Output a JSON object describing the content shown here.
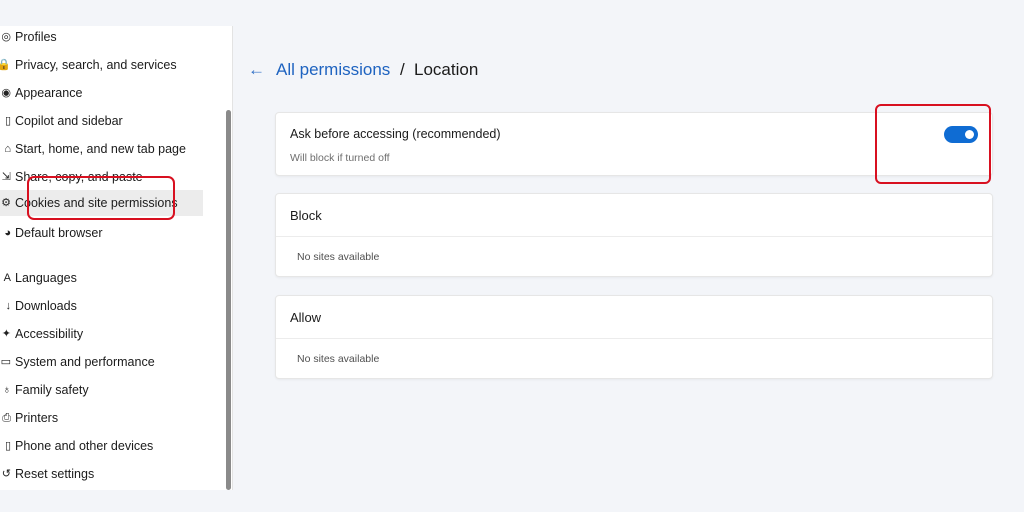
{
  "sidebar": {
    "items": [
      {
        "label": "Profiles",
        "icon": "profile-icon",
        "glyph": "◎"
      },
      {
        "label": "Privacy, search, and services",
        "icon": "lock-icon",
        "glyph": "🔒"
      },
      {
        "label": "Appearance",
        "icon": "appearance-icon",
        "glyph": "◉"
      },
      {
        "label": "Copilot and sidebar",
        "icon": "sidebar-icon",
        "glyph": "▯"
      },
      {
        "label": "Start, home, and new tab page",
        "icon": "home-icon",
        "glyph": "⌂"
      },
      {
        "label": "Share, copy, and paste",
        "icon": "share-icon",
        "glyph": "⇲"
      },
      {
        "label": "Cookies and site permissions",
        "icon": "cookie-icon",
        "glyph": "⚙"
      },
      {
        "label": "Default browser",
        "icon": "browser-icon",
        "glyph": "◕"
      },
      {
        "label": "Languages",
        "icon": "languages-icon",
        "glyph": "A"
      },
      {
        "label": "Downloads",
        "icon": "download-icon",
        "glyph": "↓"
      },
      {
        "label": "Accessibility",
        "icon": "accessibility-icon",
        "glyph": "✦"
      },
      {
        "label": "System and performance",
        "icon": "system-icon",
        "glyph": "▭"
      },
      {
        "label": "Family safety",
        "icon": "family-icon",
        "glyph": "♁"
      },
      {
        "label": "Printers",
        "icon": "printer-icon",
        "glyph": "⎙"
      },
      {
        "label": "Phone and other devices",
        "icon": "phone-icon",
        "glyph": "▯"
      },
      {
        "label": "Reset settings",
        "icon": "reset-icon",
        "glyph": "↺"
      }
    ]
  },
  "header": {
    "back_icon": "←",
    "crumb_link": "All permissions",
    "separator": "/",
    "current": "Location"
  },
  "ask_card": {
    "title": "Ask before accessing (recommended)",
    "subtitle": "Will block if turned off",
    "toggle_on": true
  },
  "block": {
    "title": "Block",
    "empty": "No sites available"
  },
  "allow": {
    "title": "Allow",
    "empty": "No sites available"
  },
  "colors": {
    "accent": "#0f6cd3",
    "link": "#1e63c0",
    "annotation": "#d81020"
  }
}
